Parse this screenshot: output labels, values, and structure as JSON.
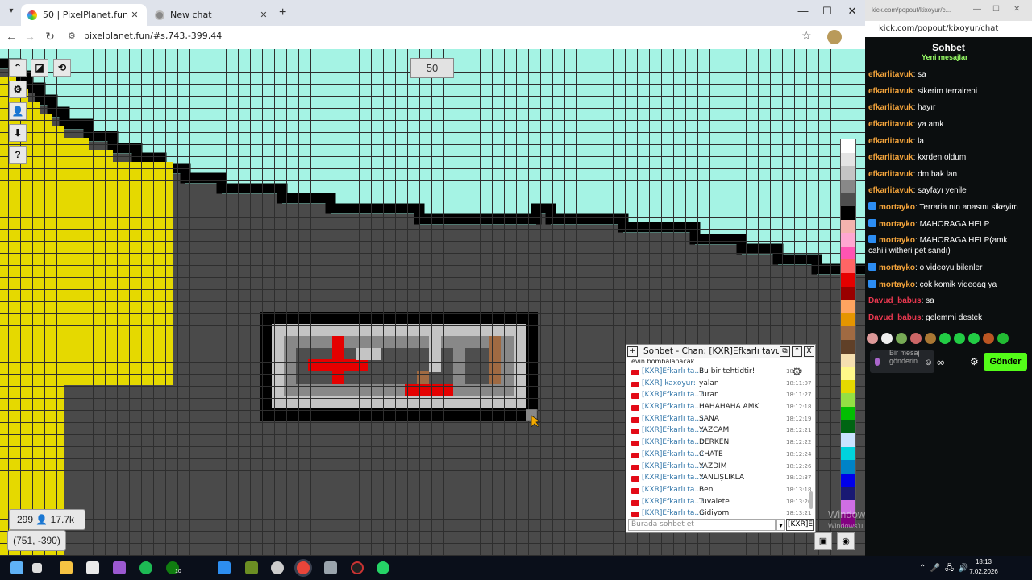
{
  "browser": {
    "tabs": [
      {
        "title": "50 | PixelPlanet.fun",
        "active": true
      },
      {
        "title": "New chat",
        "active": false
      }
    ],
    "url": "pixelplanet.fun/#s,743,-399,44"
  },
  "game": {
    "zoom_label": "50",
    "online_count": "299",
    "pixel_count": "17.7k",
    "coords": "(751, -390)",
    "palette": [
      "#ffffff",
      "#e4e4e4",
      "#c4c4c4",
      "#888888",
      "#4e4e4e",
      "#000000",
      "#f4b3ae",
      "#ffa7d1",
      "#ff54b2",
      "#ff6565",
      "#e50000",
      "#9a0000",
      "#fea460",
      "#e59500",
      "#a06a42",
      "#604028",
      "#f5dfb0",
      "#fff889",
      "#e5d900",
      "#94e044",
      "#02be01",
      "#006513",
      "#cae3ff",
      "#00d3dd",
      "#0083c7",
      "#0000ea",
      "#191973",
      "#cf6ee4",
      "#820080"
    ],
    "chat": {
      "title": "Sohbet - Chan: [KXR]Efkarlı tavuk",
      "partial_line": "evin bombalanacak",
      "messages": [
        {
          "name": "[KXR]Efkarlı ta...:",
          "text": "Bu bir tehtidtir!",
          "time": "18:10"
        },
        {
          "name": "[KXR] kaxoyur:",
          "text": "yalan",
          "time": "18:11:07"
        },
        {
          "name": "[KXR]Efkarlı ta...:",
          "text": "Turan",
          "time": "18:11:27"
        },
        {
          "name": "[KXR]Efkarlı ta...:",
          "text": "HAHAHAHA AMK",
          "time": "18:12:18"
        },
        {
          "name": "[KXR]Efkarlı ta...:",
          "text": "SANA",
          "time": "18:12:19"
        },
        {
          "name": "[KXR]Efkarlı ta...:",
          "text": "YAZCAM",
          "time": "18:12:21"
        },
        {
          "name": "[KXR]Efkarlı ta...:",
          "text": "DERKEN",
          "time": "18:12:22"
        },
        {
          "name": "[KXR]Efkarlı ta...:",
          "text": "CHATE",
          "time": "18:12:24"
        },
        {
          "name": "[KXR]Efkarlı ta...:",
          "text": "YAZDIM",
          "time": "18:12:26"
        },
        {
          "name": "[KXR]Efkarlı ta...:",
          "text": "YANLIŞLIKLA",
          "time": "18:12:37"
        },
        {
          "name": "[KXR]Efkarlı ta...:",
          "text": "Ben",
          "time": "18:13:18"
        },
        {
          "name": "[KXR]Efkarlı ta...:",
          "text": "Tuvalete",
          "time": "18:13:20"
        },
        {
          "name": "[KXR]Efkarlı ta...:",
          "text": "Gidiyom",
          "time": "18:13:21"
        }
      ],
      "input_placeholder": "Burada sohbet et",
      "channel_button": "[KXR]E"
    }
  },
  "watermark": {
    "line1": "Windows'u Etkinleştir",
    "line2": "Windows'u etkinleştirmek için Ayarlar'a gidin."
  },
  "kick": {
    "window_title": "kick.com/popout/kixoyur/c...",
    "url": "kick.com/popout/kixoyur/chat",
    "header": "Sohbet",
    "new_messages": "Yeni mesajlar",
    "colors": {
      "efkar": "#f2a33b",
      "morta": "#f2a33b",
      "davud": "#e8384f",
      "send": "#53fc18"
    },
    "messages": [
      {
        "user": "efkarlitavuk",
        "text": ": sa",
        "badge": false,
        "color": "#f2a33b"
      },
      {
        "user": "efkarlitavuk",
        "text": ": sikerim terraireni",
        "badge": false,
        "color": "#f2a33b"
      },
      {
        "user": "efkarlitavuk",
        "text": ": hayır",
        "badge": false,
        "color": "#f2a33b"
      },
      {
        "user": "efkarlitavuk",
        "text": ": ya amk",
        "badge": false,
        "color": "#f2a33b"
      },
      {
        "user": "efkarlitavuk",
        "text": ": la",
        "badge": false,
        "color": "#f2a33b"
      },
      {
        "user": "efkarlitavuk",
        "text": ": kxrden oldum",
        "badge": false,
        "color": "#f2a33b"
      },
      {
        "user": "efkarlitavuk",
        "text": ": dm bak lan",
        "badge": false,
        "color": "#f2a33b"
      },
      {
        "user": "efkarlitavuk",
        "text": ": sayfayı yenile",
        "badge": false,
        "color": "#f2a33b"
      },
      {
        "user": "mortayko",
        "text": ": Terraria nın anasını sikeyim",
        "badge": true,
        "color": "#f2a33b"
      },
      {
        "user": "mortayko",
        "text": ": MAHORAGA HELP",
        "badge": true,
        "color": "#f2a33b"
      },
      {
        "user": "mortayko",
        "text": ": MAHORAGA HELP(amk cahili witheri pet sandı)",
        "badge": true,
        "color": "#f2a33b"
      },
      {
        "user": "mortayko",
        "text": ": o videoyu bilenler",
        "badge": true,
        "color": "#f2a33b"
      },
      {
        "user": "mortayko",
        "text": ": çok komik videoaq ya",
        "badge": true,
        "color": "#f2a33b"
      },
      {
        "user": "Davud_babus",
        "text": ": sa",
        "badge": false,
        "color": "#e8384f"
      },
      {
        "user": "Davud_babus",
        "text": ": gelemmi destek",
        "badge": false,
        "color": "#e8384f"
      }
    ],
    "input_placeholder": "Bir mesaj gönderin",
    "send_label": "Gönder"
  },
  "taskbar": {
    "time": "18:13",
    "date": "7.02.2026",
    "spotify_badge": "10"
  }
}
